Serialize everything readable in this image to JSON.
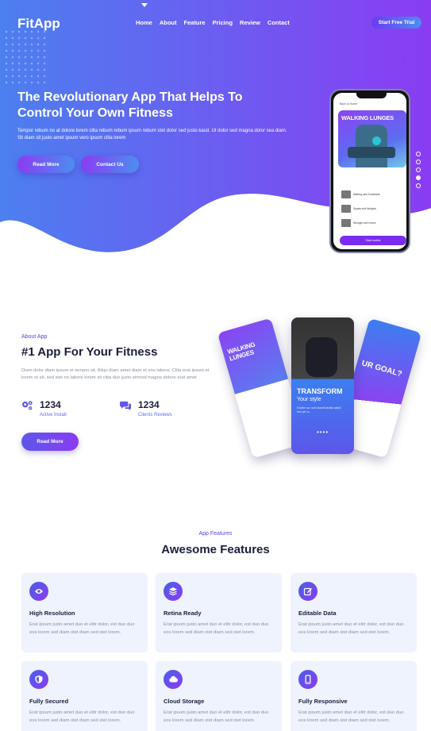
{
  "nav": {
    "logo": "FitApp",
    "links": [
      "Home",
      "About",
      "Feature",
      "Pricing",
      "Review",
      "Contact"
    ],
    "cta": "Start Free Trial"
  },
  "hero": {
    "title": "The Revolutionary App That Helps To Control Your Own Fitness",
    "subtitle": "Tempor rebum no at dolore lorem clita rebum rebum ipsum rebum stet dolor sed justo kasd. Ut dolor sed magna dolor sea diam. Sit diam sit justo amet ipsum vero ipsum clita lorem",
    "read_more": "Read More",
    "contact_us": "Contact Us",
    "side_dots": 5,
    "active_dot": 4
  },
  "phone": {
    "header": "Back to Home",
    "banner": "WALKING LUNGES",
    "rows": [
      "Walking with Dumbbells",
      "Squats with Weights",
      "Strength with Knees"
    ],
    "button": "Start routine"
  },
  "about": {
    "eyebrow": "About App",
    "title": "#1 App For Your Fitness",
    "text": "Diam dolor diam ipsum et tempor sit. Aliqu diam amet diam et eos labore. Clita erat ipsum et lorem et sit, sed stet no labore lorem sit clita duo justo eirmod magna dolore erat amet",
    "stats": [
      {
        "value": "1234",
        "label": "Active Install",
        "icon": "gears-icon"
      },
      {
        "value": "1234",
        "label": "Clients Reviews",
        "icon": "comments-icon"
      }
    ],
    "read_more": "Read More"
  },
  "mockups": {
    "left_title": "WALKING LUNGES",
    "center_title": "TRANSFORM",
    "center_sub": "Your style",
    "center_text": "Enable non nam blandit facilisi adipis rem per tu.",
    "right_title": "UR GOAL?"
  },
  "features": {
    "eyebrow": "App Features",
    "title": "Awesome Features",
    "items": [
      {
        "title": "High Resolution",
        "text": "Erat ipsum justo amet duo et elitr dolor, est duo duo eos lorem sed diam stet diam sed stet lorem.",
        "icon": "eye-icon"
      },
      {
        "title": "Retina Ready",
        "text": "Erat ipsum justo amet duo et elitr dolor, est duo duo eos lorem sed diam stet diam sed stet lorem.",
        "icon": "layers-icon"
      },
      {
        "title": "Editable Data",
        "text": "Erat ipsum justo amet duo et elitr dolor, est duo duo eos lorem sed diam stet diam sed stet lorem.",
        "icon": "edit-icon"
      },
      {
        "title": "Fully Secured",
        "text": "Erat ipsum justo amet duo et elitr dolor, est duo duo eos lorem sed diam stet diam sed stet lorem.",
        "icon": "shield-icon"
      },
      {
        "title": "Cloud Storage",
        "text": "Erat ipsum justo amet duo et elitr dolor, est duo duo eos lorem sed diam stet diam sed stet lorem.",
        "icon": "cloud-icon"
      },
      {
        "title": "Fully Responsive",
        "text": "Erat ipsum justo amet duo et elitr dolor, est duo duo eos lorem sed diam stet diam sed stet lorem.",
        "icon": "mobile-icon"
      }
    ]
  },
  "colors": {
    "primary": "#5d3ee6",
    "gradient_start": "#8a3cf2",
    "gradient_end": "#4c8ef0",
    "card_bg": "#eef3fd"
  }
}
